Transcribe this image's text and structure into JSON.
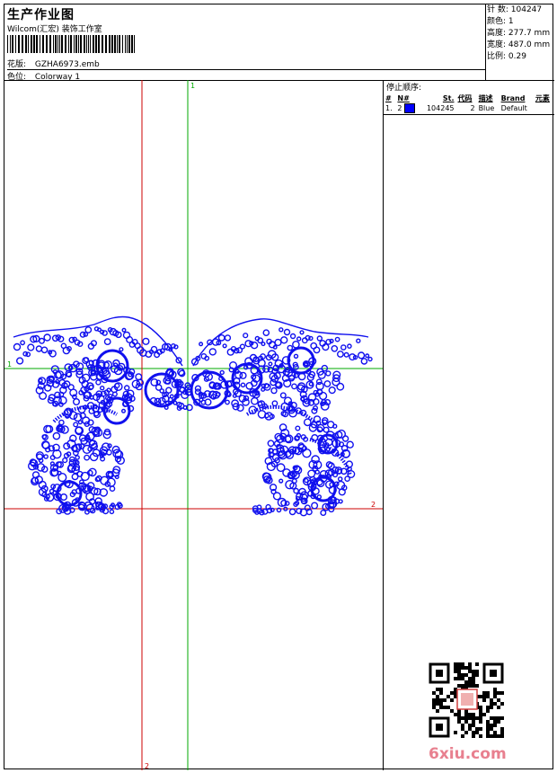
{
  "header": {
    "title": "生产作业图",
    "subtitle": "Wilcom(汇宏) 装饰工作室",
    "design_label": "花版:",
    "design_value": "GZHA6973.emb",
    "colorway_label": "色位:",
    "colorway_value": "Colorway 1"
  },
  "stats": [
    {
      "label": "针 数:",
      "value": "104247"
    },
    {
      "label": "颜色:",
      "value": "1"
    },
    {
      "label": "高度:",
      "value": "277.7 mm"
    },
    {
      "label": "宽度:",
      "value": "487.0 mm"
    },
    {
      "label": "比例:",
      "value": "0.29"
    }
  ],
  "stop_sequence": {
    "title": "停止顺序:",
    "columns": [
      "#",
      "N#",
      "St.",
      "代码",
      "描述",
      "Brand",
      "元素"
    ],
    "rows": [
      {
        "index": "1.",
        "needle": "2",
        "swatch_color": "#0000ff",
        "stitches": "104245",
        "code": "2",
        "description": "Blue",
        "brand": "Default",
        "element": ""
      }
    ]
  },
  "axis_labels": {
    "green_top": "1",
    "green_left": "1",
    "red_right": "2",
    "red_bottom": "2"
  },
  "colors": {
    "stitch": "#1010ee",
    "green_axis": "#00aa00",
    "red_axis": "#cc0000",
    "watermark": "#e8808f"
  },
  "watermark": "6xiu.com"
}
